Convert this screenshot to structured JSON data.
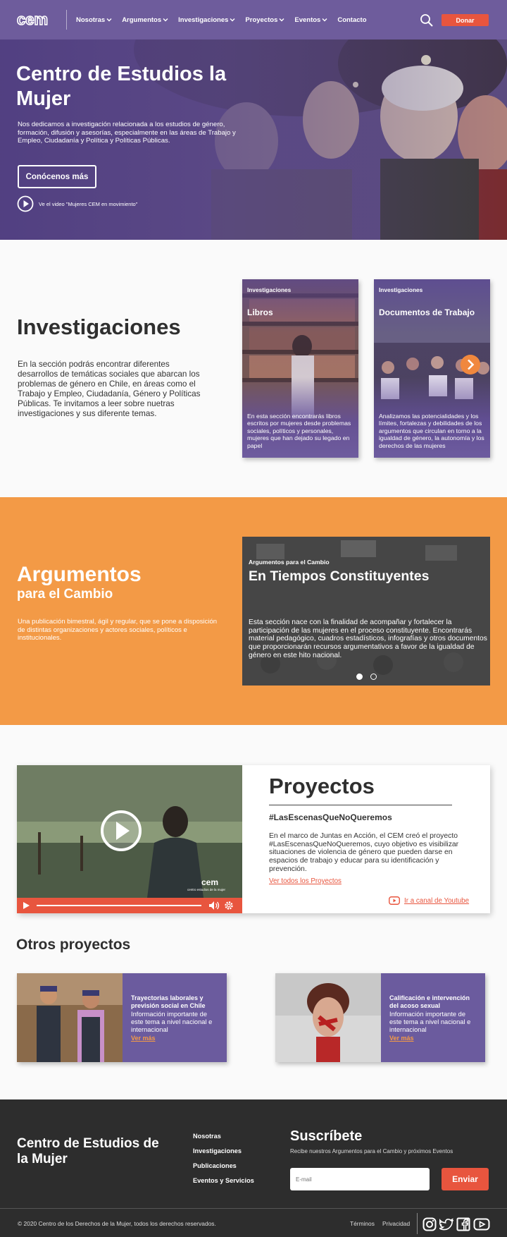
{
  "nav": {
    "logo": "cem",
    "menu": [
      {
        "label": "Nosotras"
      },
      {
        "label": "Argumentos"
      },
      {
        "label": "Investigaciones"
      },
      {
        "label": "Proyectos"
      },
      {
        "label": "Eventos"
      },
      {
        "label": "Contacto"
      }
    ],
    "search_icon": "search-icon",
    "donate_label": "Donar"
  },
  "hero": {
    "title": "Centro de Estudios la Mujer",
    "text": "Nos dedicamos a investigación relacionada a los estudios de género, formación, difusión y asesorías, especialmente en las áreas de Trabajo y Empleo, Ciudadanía y Política y Políticas Públicas.",
    "button_label": "Conócenos más",
    "video_label": "Ve el video \"Mujeres CEM en movimiento\""
  },
  "investigaciones": {
    "title": "Investigaciones",
    "text": "En la sección podrás encontrar diferentes desarrollos de temáticas sociales que abarcan los problemas de género en Chile, en áreas como el Trabajo y Empleo, Ciudadanía, Género y Políticas Públicas. Te invitamos a leer sobre nuetras investigaciones y sus diferente temas.",
    "cards": [
      {
        "category": "Investigaciones",
        "title": "Libros",
        "description": "En esta sección encontrarás libros escritos por mujeres desde problemas sociales, políticos y personales, mujeres que han dejado su legado en papel"
      },
      {
        "category": "Investigaciones",
        "title": "Documentos de Trabajo",
        "description": "Analizamos las potencialidades y los límites, fortalezas y debilidades de los argumentos que circulan en torno a la igualdad de género, la autonomía y los derechos de las mujeres"
      }
    ]
  },
  "argumentos": {
    "title": "Argumentos",
    "subtitle": "para el Cambio",
    "text": "Una publicación bimestral, ágil y regular, que se pone a disposición de distintas organizaciones y actores sociales, políticos e institucionales.",
    "slide": {
      "category": "Argumentos para el Cambio",
      "title": "En Tiempos Constituyentes",
      "text": "Esta sección nace con la finalidad de acompañar y fortalecer la participación de las mujeres en el proceso constituyente. Encontrarás material pedagógico, cuadros estadísticos, infografías y otros documentos que proporcionarán recursos argumentativos a favor de la igualdad de género en este hito nacional."
    }
  },
  "proyectos": {
    "title": "Proyectos",
    "hashtag": "#LasEscenasQueNoQueremos",
    "text": "En el marco de Juntas en Acción, el CEM creó el proyecto #LasEscenasQueNoQueremos, cuyo objetivo es visibilizar situaciones de violencia de género que pueden darse en espacios de trabajo y educar para su identificación y prevención.",
    "link_all": "Ver todos los Proyectos",
    "link_youtube": "Ir a canal de Youtube",
    "video_watermark": "cem",
    "video_watermark_sub": "centro estudios de la mujer"
  },
  "otros": {
    "title": "Otros proyectos",
    "items": [
      {
        "title": "Trayectorias laborales y previsión social en Chile",
        "description": "Información importante de este tema a nivel nacional e internacional",
        "link": "Ver más"
      },
      {
        "title": "Calificación e intervención del acoso sexual",
        "description": "Información importante de este tema a nivel nacional e internacional",
        "link": "Ver más"
      }
    ]
  },
  "footer": {
    "title": "Centro de Estudios de la Mujer",
    "links": [
      "Nosotras",
      "Investigaciones",
      "Publicaciones",
      "Eventos y Servicios"
    ],
    "subscribe_title": "Suscríbete",
    "subscribe_text": "Recibe nuestros Argumentos para el Cambio y próximos Eventos",
    "email_placeholder": "E-mail",
    "send_label": "Enviar",
    "copyright": "© 2020 Centro de los Derechos de la Mujer, todos los derechos reservados.",
    "terms": "Términos",
    "privacy": "Privacidad",
    "social": [
      "instagram-icon",
      "twitter-icon",
      "facebook-icon",
      "youtube-icon"
    ]
  },
  "colors": {
    "purple": "#6e5c9c",
    "orange": "#f39a46",
    "red": "#e8553e",
    "dark": "#2d2d2d"
  }
}
